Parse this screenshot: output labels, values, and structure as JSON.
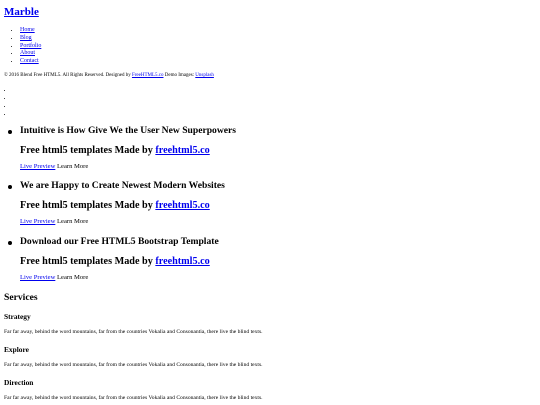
{
  "header": {
    "logo": "Marble"
  },
  "nav": {
    "items": [
      "Home",
      "Blog",
      "Portfolio",
      "About",
      "Contact"
    ]
  },
  "footer": {
    "copyright": "© 2016 Blend Free HTML5. All Rights Reserved. Designed by",
    "designer_link": "FreeHTML5.co",
    "demo_images": "Demo Images:",
    "images_link": "Unsplash"
  },
  "slides": [
    {
      "title": "Intuitive is How Give We the User New Superpowers",
      "subtitle_prefix": "Free html5 templates Made by",
      "subtitle_link": "freehtml5.co",
      "preview": "Live Preview",
      "learn": "Learn More"
    },
    {
      "title": "We are Happy to Create Newest Modern Websites",
      "subtitle_prefix": "Free html5 templates Made by",
      "subtitle_link": "freehtml5.co",
      "preview": "Live Preview",
      "learn": "Learn More"
    },
    {
      "title": "Download our Free HTML5 Bootstrap Template",
      "subtitle_prefix": "Free html5 templates Made by",
      "subtitle_link": "freehtml5.co",
      "preview": "Live Preview",
      "learn": "Learn More"
    }
  ],
  "services": {
    "title": "Services",
    "items": [
      {
        "title": "Strategy",
        "text": "Far far away, behind the word mountains, far from the countries Vokalia and Consonantia, there live the blind texts."
      },
      {
        "title": "Explore",
        "text": "Far far away, behind the word mountains, far from the countries Vokalia and Consonantia, there live the blind texts."
      },
      {
        "title": "Direction",
        "text": "Far far away, behind the word mountains, far from the countries Vokalia and Consonantia, there live the blind texts."
      }
    ]
  },
  "colors": {
    "link": "#0000ee",
    "text": "#000000",
    "background": "#ffffff"
  }
}
